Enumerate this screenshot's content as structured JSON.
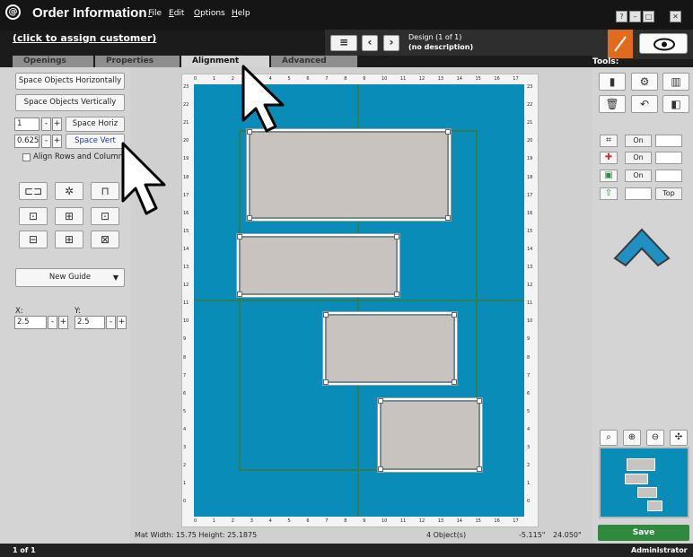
{
  "app": {
    "title": "Order Information",
    "menus": [
      "File",
      "Edit",
      "Options",
      "Help"
    ],
    "window_buttons": [
      "?",
      "–",
      "□",
      "✕"
    ]
  },
  "header": {
    "assign_customer": "(click to assign customer)",
    "design_title": "Design  (1 of 1)",
    "design_description": "(no description)"
  },
  "tabs": [
    {
      "label": "Openings",
      "active": false
    },
    {
      "label": "Properties",
      "active": false
    },
    {
      "label": "Alignment",
      "active": true
    },
    {
      "label": "Advanced",
      "active": false
    }
  ],
  "alignment": {
    "space_horizontally": "Space Objects Horizontally",
    "space_vertically": "Space Objects Vertically",
    "horiz_value": "1",
    "vert_value": "0.625",
    "space_horiz_label": "Space Horiz",
    "space_vert_label": "Space Vert",
    "align_rows_label": "Align Rows and Columns",
    "new_guide_label": "New Guide",
    "x_label": "X:",
    "y_label": "Y:",
    "x_value": "2.5",
    "y_value": "2.5"
  },
  "canvas": {
    "mat_info": "Mat  Width: 15.75  Height: 25.1875",
    "objects": "4 Object(s)",
    "x_coord": "-5.115\"",
    "y_coord": "24.050\"",
    "ruler_top": [
      "0",
      "1",
      "2",
      "3",
      "4",
      "5",
      "6",
      "7",
      "8",
      "9",
      "10",
      "11",
      "12",
      "13",
      "14",
      "15",
      "16",
      "17"
    ],
    "ruler_side": [
      "23",
      "22",
      "21",
      "20",
      "19",
      "18",
      "17",
      "16",
      "15",
      "14",
      "13",
      "12",
      "11",
      "10",
      "9",
      "8",
      "7",
      "6",
      "5",
      "4",
      "3",
      "2",
      "1",
      "0"
    ]
  },
  "tools": {
    "label": "Tools:",
    "toggles": [
      {
        "icon": "corners-icon",
        "state": "On"
      },
      {
        "icon": "crosshair-icon",
        "state": "On"
      },
      {
        "icon": "frame-icon",
        "state": "On"
      }
    ],
    "layer_position": "Top",
    "save_label": "Save"
  },
  "footer": {
    "page": "1 of 1",
    "user": "Administrator"
  },
  "colors": {
    "mat": "#0a8cb8",
    "guide": "#2f7d54",
    "save": "#2e8b3e",
    "accent": "#e26a1c"
  }
}
